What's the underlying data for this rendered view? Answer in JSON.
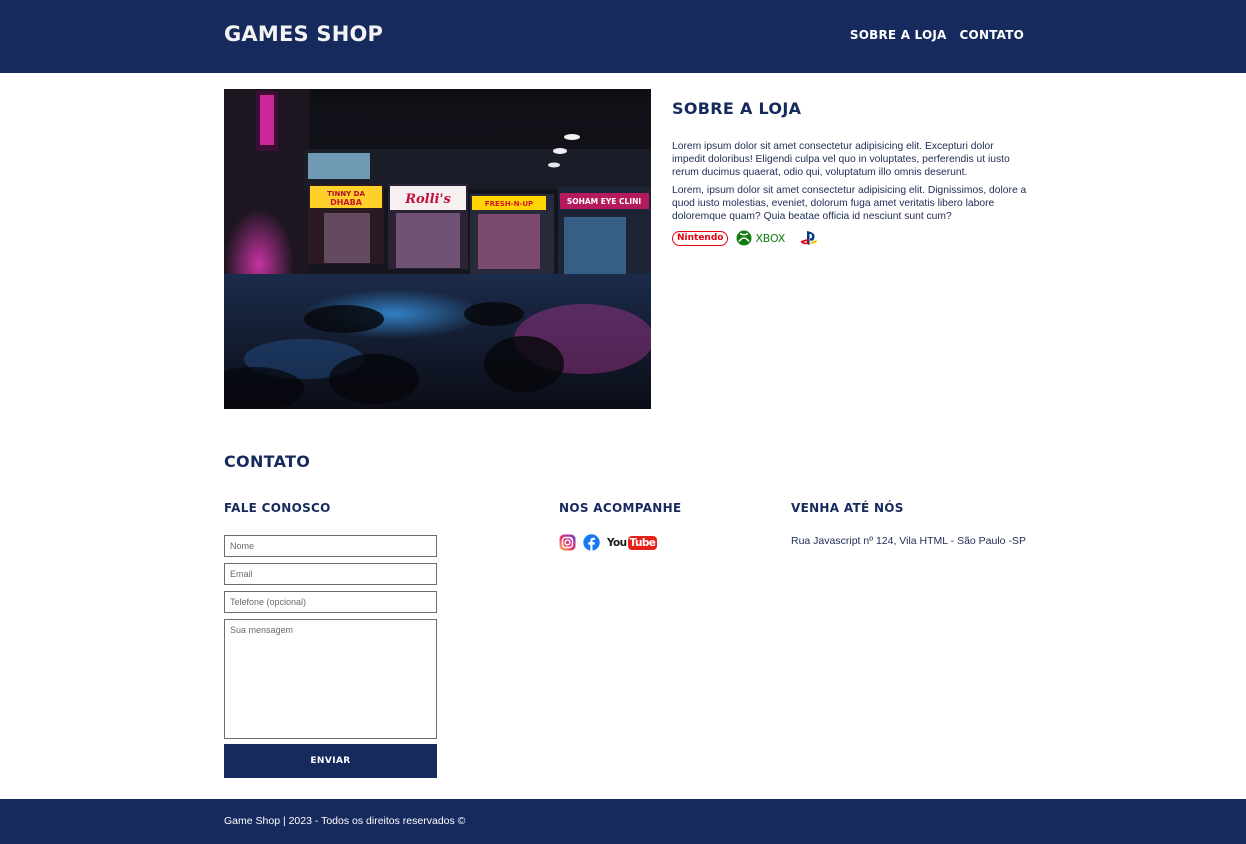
{
  "header": {
    "logo": "GAMES SHOP",
    "nav": [
      "SOBRE A LOJA",
      "CONTATO"
    ]
  },
  "about": {
    "title": "SOBRE A LOJA",
    "paragraphs": [
      "Lorem ipsum dolor sit amet consectetur adipisicing elit. Excepturi dolor impedit doloribus! Eligendi culpa vel quo in voluptates, perferendis ut iusto rerum ducimus quaerat, odio qui, voluptatum illo omnis deserunt.",
      "Lorem, ipsum dolor sit amet consectetur adipisicing elit. Dignissimos, dolore a quod iusto molestias, eveniet, dolorum fuga amet veritatis libero labore doloremque quam? Quia beatae officia id nesciunt sunt cum?"
    ],
    "photo_signs": [
      "TINNY DA DHABA",
      "Rolli's",
      "FRESH-N-UP",
      "SOHAM EYE CLINI"
    ],
    "brands": [
      {
        "icon": "nintendo-logo",
        "text": "Nintendo",
        "color": "#e60012"
      },
      {
        "icon": "xbox-logo",
        "text": "XBOX",
        "color": "#107c10"
      },
      {
        "icon": "playstation-logo",
        "text": "",
        "color": "#003791"
      }
    ]
  },
  "contact": {
    "title": "CONTATO",
    "form": {
      "title": "FALE CONOSCO",
      "name_placeholder": "Nome",
      "email_placeholder": "Email",
      "phone_placeholder": "Telefone (opcional)",
      "message_placeholder": "Sua mensagem",
      "submit_label": "ENVIAR"
    },
    "social": {
      "title": "NOS ACOMPANHE",
      "items": [
        {
          "icon": "instagram-icon"
        },
        {
          "icon": "facebook-icon",
          "color": "#1877f2"
        },
        {
          "icon": "youtube-icon",
          "text_you": "You",
          "text_tube": "Tube",
          "color": "#e62117"
        }
      ]
    },
    "location": {
      "title": "VENHA ATÉ NÓS",
      "address": "Rua Javascript nº 124, Vila HTML - São Paulo -SP"
    }
  },
  "footer": {
    "copyright": "Game Shop | 2023 - Todos os direitos reservados ©"
  },
  "colors": {
    "primary": "#172a5e",
    "background": "#ffffff",
    "text": "#1f2b55"
  }
}
